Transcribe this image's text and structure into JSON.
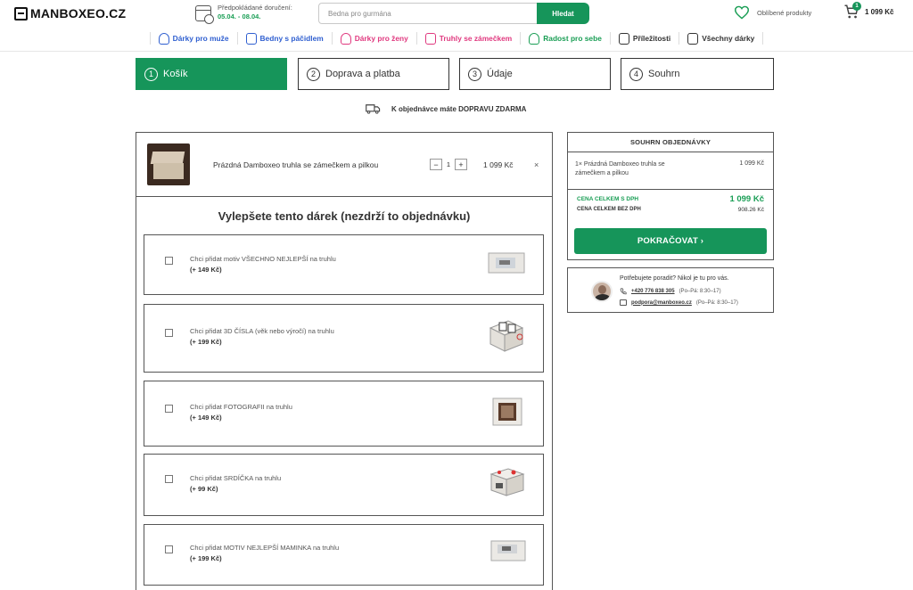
{
  "header": {
    "logo_text": "MANBOXEO.CZ",
    "delivery_label": "Předpokládané doručení:",
    "delivery_dates": "05.04. - 08.04.",
    "search_placeholder": "Bedna pro gurmána",
    "search_button": "Hledat",
    "favorites_label": "Oblíbené produkty",
    "cart_count": "1",
    "cart_total": "1 099 Kč",
    "accent_color": "#16955a"
  },
  "nav": {
    "items": [
      {
        "label": "Dárky pro muže",
        "color": "#2f5fd0"
      },
      {
        "label": "Bedny s páčidlem",
        "color": "#2f5fd0"
      },
      {
        "label": "Dárky pro ženy",
        "color": "#e0397f"
      },
      {
        "label": "Truhly se zámečkem",
        "color": "#e0397f"
      },
      {
        "label": "Radost pro sebe",
        "color": "#1a9e55"
      },
      {
        "label": "Příležitosti",
        "color": "#333333"
      },
      {
        "label": "Všechny dárky",
        "color": "#333333"
      }
    ]
  },
  "steps": [
    {
      "num": "1",
      "label": "Košík"
    },
    {
      "num": "2",
      "label": "Doprava a platba"
    },
    {
      "num": "3",
      "label": "Údaje"
    },
    {
      "num": "4",
      "label": "Souhrn"
    }
  ],
  "free_shipping": "K objednávce máte DOPRAVU ZDARMA",
  "cart": {
    "product_name": "Prázdná Damboxeo truhla se zámečkem a pilkou",
    "qty_minus": "−",
    "qty": "1",
    "qty_plus": "+",
    "price": "1 099 Kč",
    "remove": "×"
  },
  "upgrade": {
    "title": "Vylepšete tento dárek (nezdrží to objednávku)",
    "options": [
      {
        "text": "Chci přidat motiv VŠECHNO NEJLEPŠÍ na truhlu",
        "price": "(+ 149 Kč)"
      },
      {
        "text": "Chci přidat 3D ČÍSLA (věk nebo výročí) na truhlu",
        "price": "(+ 199 Kč)"
      },
      {
        "text": "Chci přidat FOTOGRAFII na truhlu",
        "price": "(+ 149 Kč)"
      },
      {
        "text": "Chci přidat SRDÍČKA na truhlu",
        "price": "(+ 99 Kč)"
      },
      {
        "text": "Chci přidat MOTIV NEJLEPŠÍ MAMINKA na truhlu",
        "price": "(+ 199 Kč)"
      }
    ]
  },
  "summary": {
    "title": "SOUHRN OBJEDNÁVKY",
    "item": "1× Prázdná Damboxeo truhla se zámečkem a pilkou",
    "item_price": "1 099 Kč",
    "total_label": "CENA CELKEM S DPH",
    "total": "1 099 Kč",
    "net_label": "CENA CELKEM BEZ DPH",
    "net": "908.26 Kč",
    "continue": "POKRAČOVAT ›"
  },
  "help": {
    "title": "Potřebujete poradit? Nikol je tu pro vás.",
    "phone": "+420 776 838 305",
    "phone_hours": "(Po–Pá: 8:30–17)",
    "email": "podpora@manboxeo.cz",
    "email_hours": "(Po–Pá: 8:30–17)"
  }
}
